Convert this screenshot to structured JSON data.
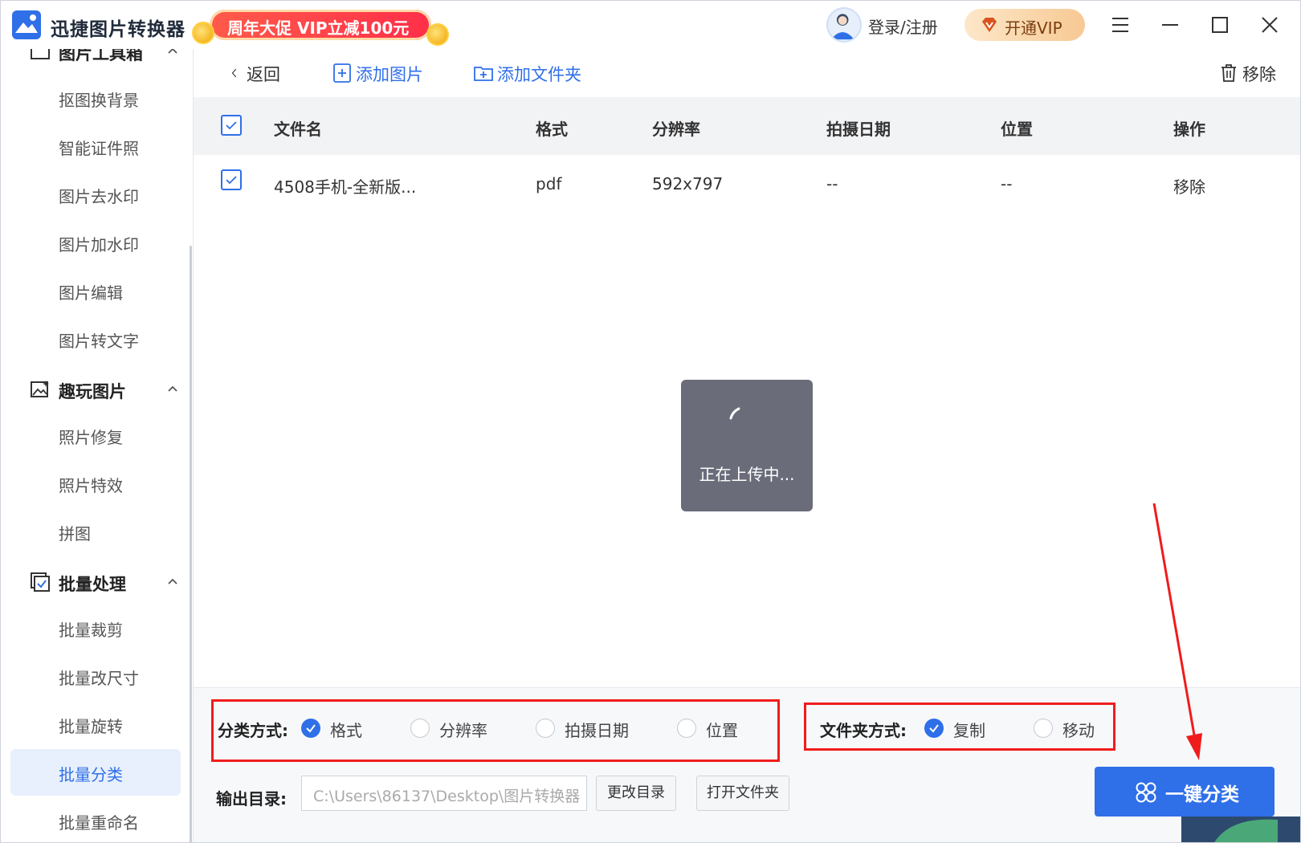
{
  "app": {
    "title": "迅捷图片转换器",
    "promo_text": "周年大促 VIP立减100元",
    "login_text": "登录/注册",
    "vip_text": "开通VIP"
  },
  "sidebar": {
    "sections": [
      {
        "label": "图片工具箱",
        "icon": "toolbox-icon"
      },
      {
        "label": "趣玩图片",
        "icon": "image-sparkle-icon"
      },
      {
        "label": "批量处理",
        "icon": "batch-check-icon"
      }
    ],
    "items": [
      {
        "label": "抠图换背景"
      },
      {
        "label": "智能证件照"
      },
      {
        "label": "图片去水印"
      },
      {
        "label": "图片加水印"
      },
      {
        "label": "图片编辑"
      },
      {
        "label": "图片转文字"
      },
      {
        "label": "照片修复"
      },
      {
        "label": "照片特效"
      },
      {
        "label": "拼图"
      },
      {
        "label": "批量裁剪"
      },
      {
        "label": "批量改尺寸"
      },
      {
        "label": "批量旋转"
      },
      {
        "label": "批量分类"
      },
      {
        "label": "批量重命名"
      }
    ],
    "active_item": "批量分类"
  },
  "toolbar": {
    "back_label": "返回",
    "add_image_label": "添加图片",
    "add_folder_label": "添加文件夹",
    "remove_label": "移除"
  },
  "table": {
    "columns": [
      "文件名",
      "格式",
      "分辨率",
      "拍摄日期",
      "位置",
      "操作"
    ],
    "rows": [
      {
        "filename": "4508手机-全新版...",
        "format": "pdf",
        "resolution": "592x797",
        "date": "--",
        "location": "--",
        "action": "移除"
      }
    ]
  },
  "toast": {
    "message": "正在上传中..."
  },
  "options": {
    "classify_label": "分类方式:",
    "classify_options": [
      "格式",
      "分辨率",
      "拍摄日期",
      "位置"
    ],
    "classify_selected": "格式",
    "folder_label": "文件夹方式:",
    "folder_options": [
      "复制",
      "移动"
    ],
    "folder_selected": "复制",
    "output_label": "输出目录:",
    "output_path": "C:\\Users\\86137\\Desktop\\图片转换器",
    "change_dir_label": "更改目录",
    "open_folder_label": "打开文件夹"
  },
  "primary": {
    "label": "一键分类"
  },
  "colors": {
    "accent": "#2f6fe8",
    "annotation": "#f01c1c",
    "promo": "#ff3b4a"
  }
}
